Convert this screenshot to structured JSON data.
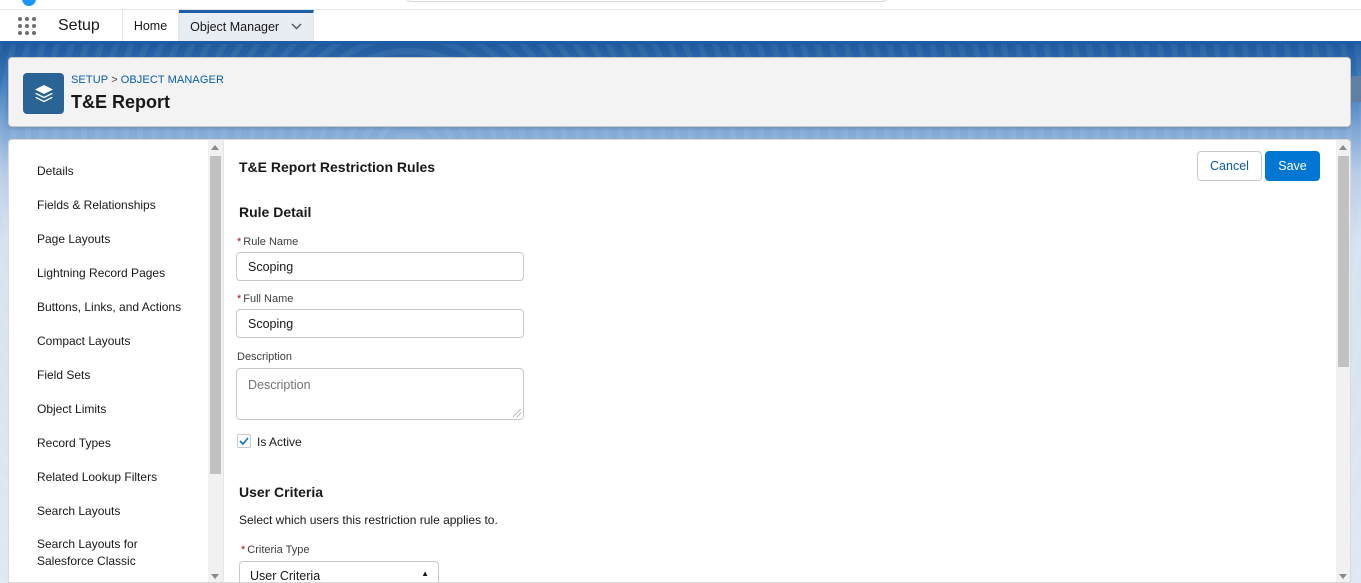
{
  "nav": {
    "app_name": "Setup",
    "tabs": [
      {
        "label": "Home"
      },
      {
        "label": "Object Manager"
      }
    ]
  },
  "header": {
    "breadcrumb": {
      "setup": "SETUP",
      "separator": ">",
      "object_manager": "OBJECT MANAGER"
    },
    "title": "T&E Report",
    "icon": "layers-icon"
  },
  "sidebar": {
    "items": [
      {
        "label": "Details"
      },
      {
        "label": "Fields & Relationships"
      },
      {
        "label": "Page Layouts"
      },
      {
        "label": "Lightning Record Pages"
      },
      {
        "label": "Buttons, Links, and Actions"
      },
      {
        "label": "Compact Layouts"
      },
      {
        "label": "Field Sets"
      },
      {
        "label": "Object Limits"
      },
      {
        "label": "Record Types"
      },
      {
        "label": "Related Lookup Filters"
      },
      {
        "label": "Search Layouts"
      },
      {
        "label": "Search Layouts for Salesforce Classic"
      }
    ]
  },
  "content": {
    "title": "T&E Report Restriction Rules",
    "cancel_label": "Cancel",
    "save_label": "Save",
    "rule_detail": {
      "heading": "Rule Detail",
      "required_marker": "*",
      "rule_name_label": "Rule Name",
      "rule_name_value": "Scoping",
      "full_name_label": "Full Name",
      "full_name_value": "Scoping",
      "description_label": "Description",
      "description_placeholder": "Description",
      "is_active_label": "Is Active",
      "is_active_checked": true
    },
    "user_criteria": {
      "heading": "User Criteria",
      "help_text": "Select which users this restriction rule applies to.",
      "criteria_type_label": "Criteria Type",
      "criteria_type_value": "User Criteria"
    }
  },
  "colors": {
    "brand_blue": "#0176d3",
    "link_blue": "#0b5cab",
    "required_red": "#ba0517",
    "nav_accent": "#1b5ea6",
    "object_icon_bg": "#2a6496"
  }
}
